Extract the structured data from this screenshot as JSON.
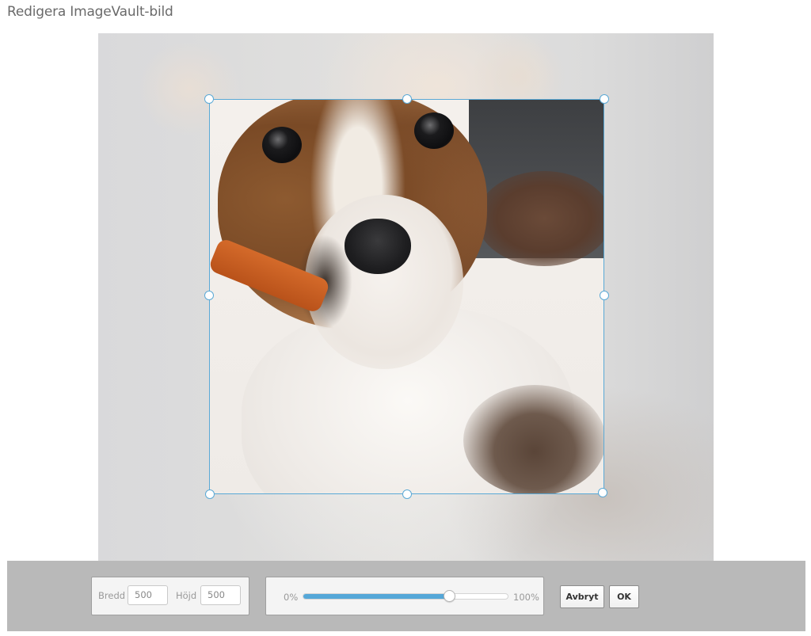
{
  "dialog": {
    "title": "Redigera ImageVault-bild"
  },
  "image": {
    "subject": "puppy"
  },
  "crop": {
    "accent_color": "#5aa9d6"
  },
  "toolbar": {
    "width_label": "Bredd",
    "width_value": "500",
    "height_label": "Höjd",
    "height_value": "500",
    "zoom_min_label": "0%",
    "zoom_max_label": "100%",
    "zoom_level": 0.71,
    "cancel_label": "Avbryt",
    "ok_label": "OK"
  },
  "colors": {
    "toolbar_bg": "#b9b9b9",
    "slider_fill": "#55a7d8"
  }
}
